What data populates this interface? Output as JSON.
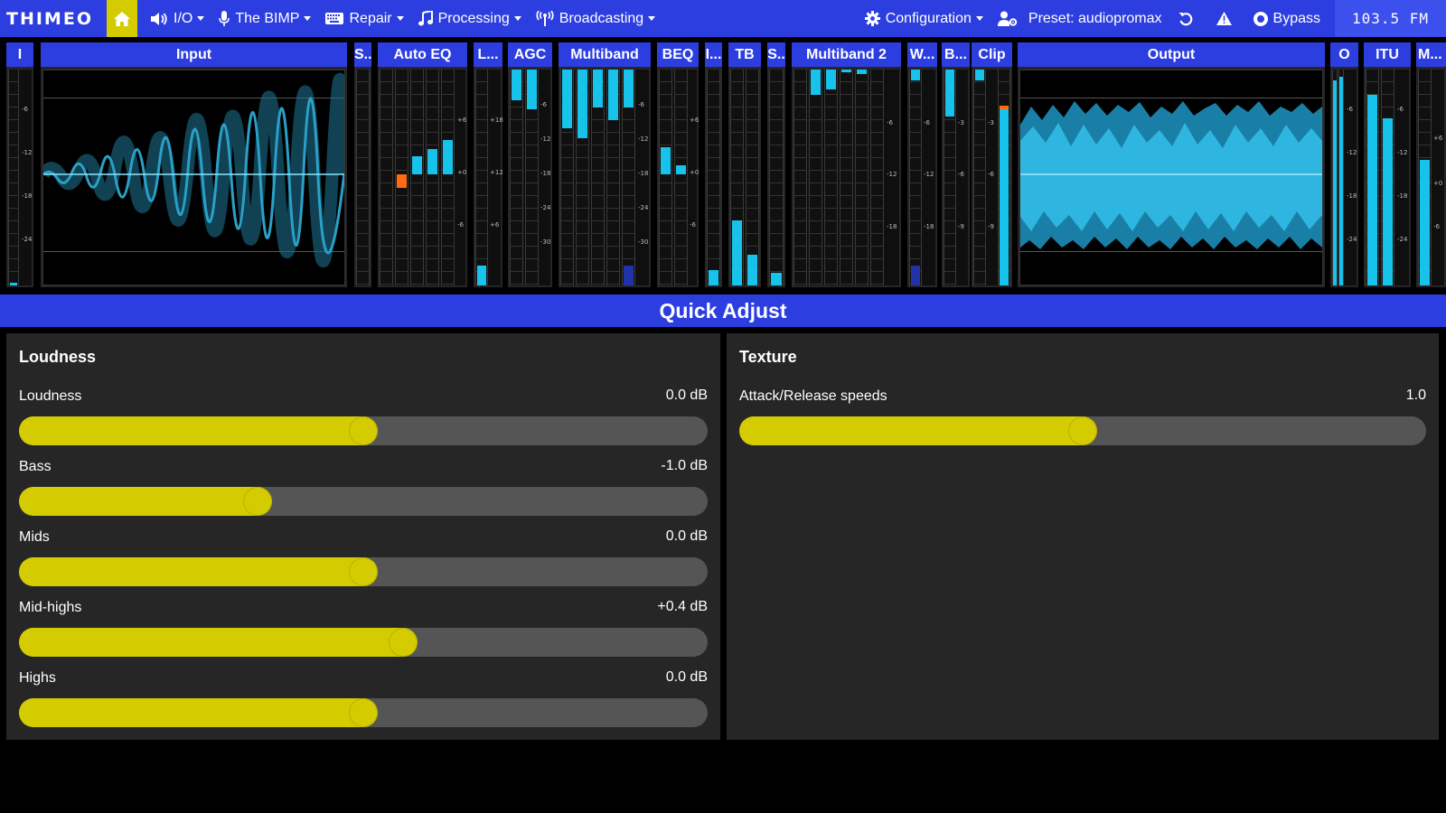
{
  "app": {
    "brand": "THIMEO"
  },
  "nav": {
    "io": "I/O",
    "bimp": "The BIMP",
    "repair": "Repair",
    "processing": "Processing",
    "broadcasting": "Broadcasting",
    "configuration": "Configuration",
    "preset": "Preset: audiopromax",
    "bypass": "Bypass",
    "station": "103.5 FM"
  },
  "meters": {
    "i": "I",
    "input": "Input",
    "s1": "S..",
    "auto_eq": "Auto EQ",
    "l": "L...",
    "agc": "AGC",
    "multiband": "Multiband",
    "beq": "BEQ",
    "i2": "I...",
    "tb": "TB",
    "s2": "S..",
    "multiband2": "Multiband 2",
    "w": "W...",
    "b": "B...",
    "clip": "Clip",
    "output": "Output",
    "o": "O",
    "itu": "ITU",
    "m": "M..."
  },
  "ticks": {
    "i": [
      "-6",
      "-12",
      "-18",
      "-24"
    ],
    "autoeq": [
      "+6",
      "+0",
      "-6"
    ],
    "l": [
      "+18",
      "+12",
      "+6"
    ],
    "agc": [
      "-6",
      "-12",
      "-18",
      "-24",
      "-30"
    ],
    "multiband": [
      "-6",
      "-12",
      "-18",
      "-24",
      "-30"
    ],
    "beq": [
      "+6",
      "+0",
      "-6"
    ],
    "multiband2": [
      "-6",
      "-12",
      "-18"
    ],
    "w": [
      "-6",
      "-12",
      "-18"
    ],
    "b": [
      "-3",
      "-6",
      "-9"
    ],
    "clip": [
      "-3",
      "-6",
      "-9"
    ],
    "o": [
      "-6",
      "-12",
      "-18",
      "-24"
    ],
    "itu": [
      "-6",
      "-12",
      "-18",
      "-24"
    ],
    "m": [
      "+6",
      "+0",
      "-6"
    ]
  },
  "quick_adjust": {
    "title": "Quick Adjust",
    "loudness_card": {
      "title": "Loudness",
      "sliders": [
        {
          "label": "Loudness",
          "value": "0.0 dB",
          "level": 0.5
        },
        {
          "label": "Bass",
          "value": "-1.0 dB",
          "level": 0.34
        },
        {
          "label": "Mids",
          "value": "0.0 dB",
          "level": 0.5
        },
        {
          "label": "Mid-highs",
          "value": "+0.4 dB",
          "level": 0.56
        },
        {
          "label": "Highs",
          "value": "0.0 dB",
          "level": 0.5
        }
      ]
    },
    "texture_card": {
      "title": "Texture",
      "sliders": [
        {
          "label": "Attack/Release speeds",
          "value": "1.0",
          "level": 0.5
        }
      ]
    }
  },
  "colors": {
    "accent": "#2d3ee0",
    "slider": "#d4cc00",
    "meter": "#17c3ea"
  }
}
